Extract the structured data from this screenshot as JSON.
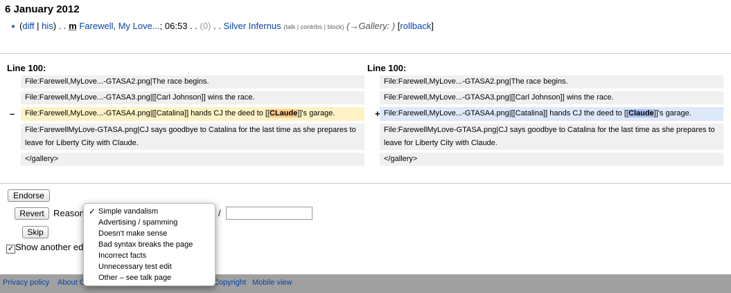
{
  "history": {
    "date": "6 January 2012",
    "diff": "diff",
    "sep": " | ",
    "his": "his",
    "dots": ". .",
    "minor": "m",
    "page": "Farewell, My Love...",
    "time": "06:53",
    "size_change": "(0)",
    "user": "Silver Infernus",
    "talk": "talk",
    "contribs": "contribs",
    "block": "block",
    "summary": "(→Gallery: )",
    "rollback": "rollback"
  },
  "diff": {
    "left_header": "Line 100:",
    "right_header": "Line 100:",
    "del_marker": "–",
    "add_marker": "+",
    "context_rows": [
      "File:Farewell,MyLove...-GTASA2.png|The race begins.",
      "File:Farewell,MyLove...-GTASA3.png|[[Carl Johnson]] wins the race."
    ],
    "changed_prefix": "File:Farewell,MyLove...-GTASA4.png|[[Catalina]] hands CJ the deed to [[",
    "changed_suffix": "]]'s garage.",
    "old_word": "CLaude",
    "new_word": "Claude",
    "after_rows": [
      "File:FarewellMyLove-GTASA.png|CJ says goodbye to Catalina for the last time as she prepares to leave for Liberty City with Claude.",
      "</gallery>"
    ]
  },
  "actions": {
    "endorse": "Endorse",
    "revert": "Revert",
    "reason_label": "Reason",
    "slash": "/",
    "skip": "Skip",
    "show_another": "Show another ed",
    "check": "✓"
  },
  "reason_menu": {
    "selected_index": 0,
    "items": [
      "Simple vandalism",
      "Advertising / spamming",
      "Doesn't make sense",
      "Bad syntax breaks the page",
      "Incorrect facts",
      "Unnecessary test edit",
      "Other – see talk page"
    ]
  },
  "footer": {
    "privacy": "Privacy policy",
    "about": "About G",
    "copyright": "Copyright",
    "mobile": "Mobile view"
  }
}
